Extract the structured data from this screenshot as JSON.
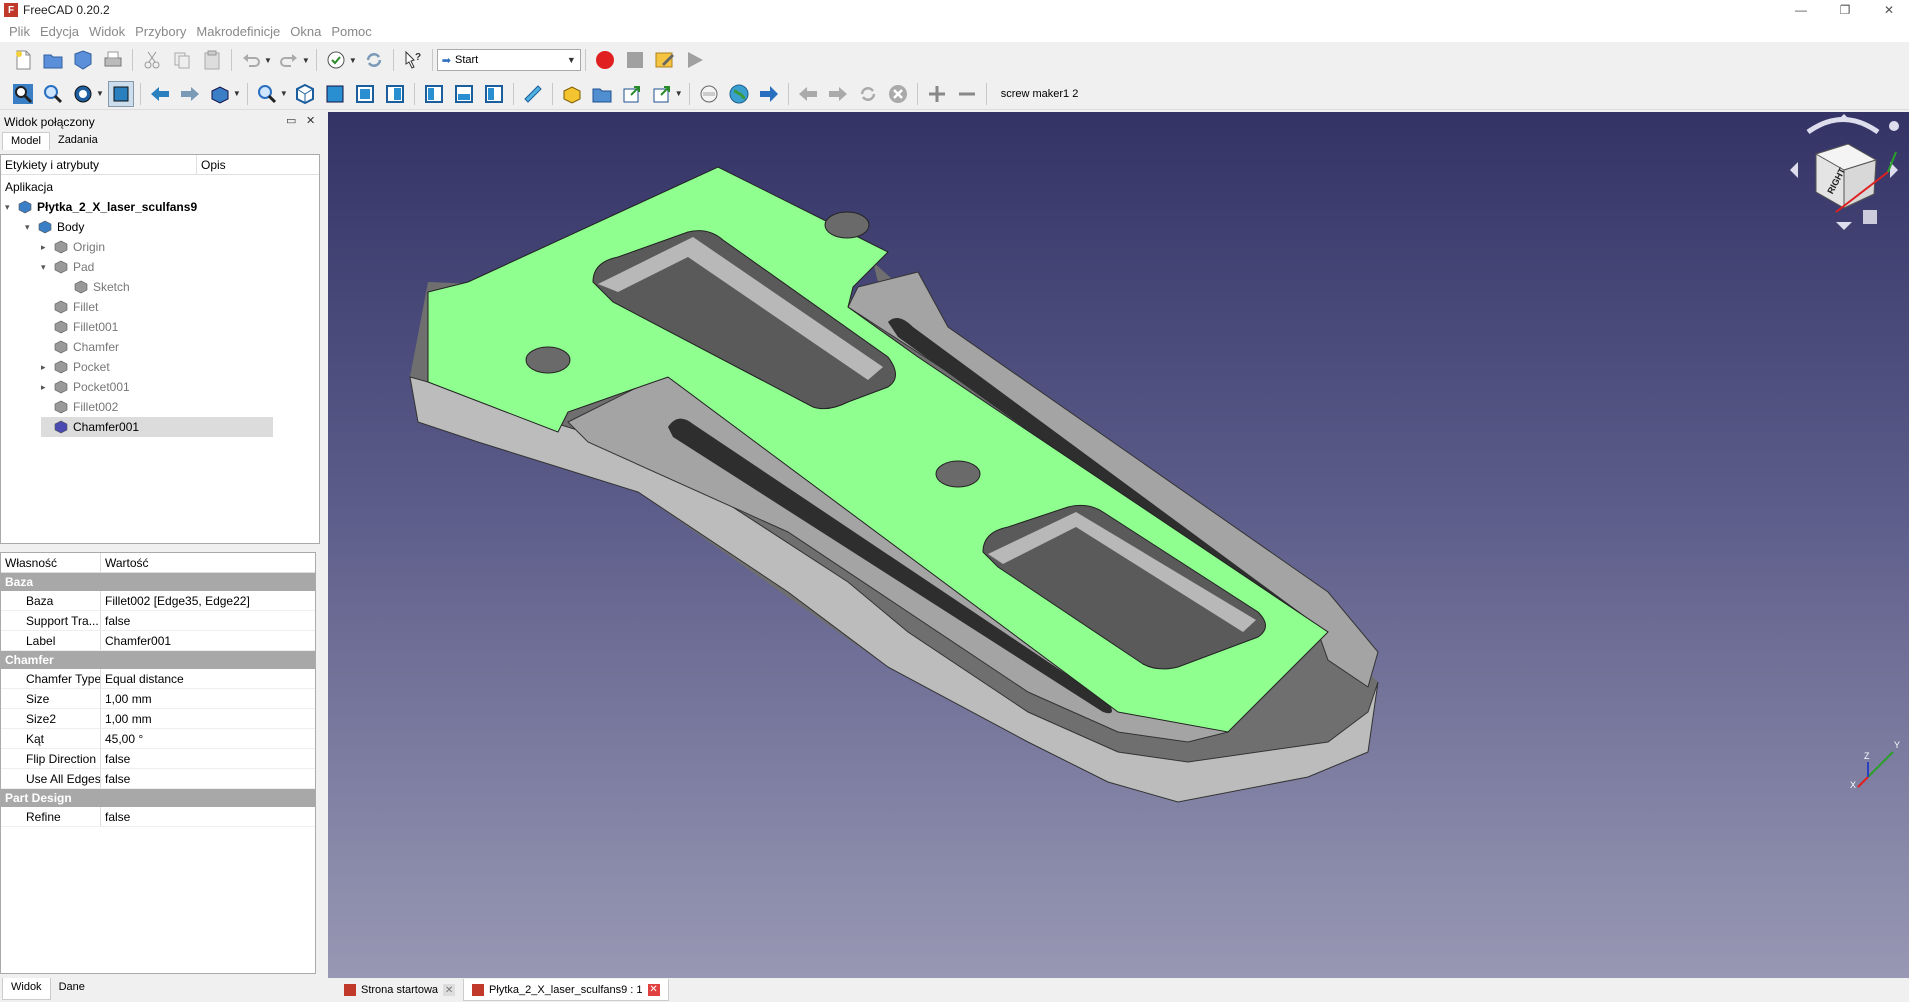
{
  "window": {
    "title": "FreeCAD 0.20.2",
    "controls": [
      "—",
      "❐",
      "✕"
    ]
  },
  "menu": [
    "Plik",
    "Edycja",
    "Widok",
    "Przybory",
    "Makrodefinicje",
    "Okna",
    "Pomoc"
  ],
  "toolbar": {
    "workbench": "Start",
    "macro_label": "screw maker1 2"
  },
  "combo_view": {
    "title": "Widok połączony",
    "float_glyph": "▭",
    "close_glyph": "✕",
    "tabs": [
      "Model",
      "Zadania"
    ],
    "tree_headers": [
      "Etykiety i atrybuty",
      "Opis"
    ],
    "application_label": "Aplikacja",
    "tree": [
      {
        "label": "Płytka_2_X_laser_sculfans9",
        "bold": true,
        "expander": "▾",
        "icon": "document"
      },
      {
        "label": "Body",
        "expander": "▾",
        "icon": "body"
      },
      {
        "label": "Origin",
        "expander": "▸",
        "icon": "origin",
        "gray": true
      },
      {
        "label": "Pad",
        "expander": "▾",
        "icon": "feature",
        "gray": true
      },
      {
        "label": "Sketch",
        "expander": "",
        "icon": "sketch",
        "gray": true
      },
      {
        "label": "Fillet",
        "expander": "",
        "icon": "feature",
        "gray": true
      },
      {
        "label": "Fillet001",
        "expander": "",
        "icon": "feature",
        "gray": true
      },
      {
        "label": "Chamfer",
        "expander": "",
        "icon": "feature",
        "gray": true
      },
      {
        "label": "Pocket",
        "expander": "▸",
        "icon": "feature",
        "gray": true
      },
      {
        "label": "Pocket001",
        "expander": "▸",
        "icon": "feature",
        "gray": true
      },
      {
        "label": "Fillet002",
        "expander": "",
        "icon": "feature",
        "gray": true
      },
      {
        "label": "Chamfer001",
        "expander": "",
        "icon": "chamfer",
        "selected": true
      }
    ]
  },
  "properties": {
    "headers": [
      "Własność",
      "Wartość"
    ],
    "groups": [
      {
        "name": "Baza",
        "rows": [
          {
            "key": "Baza",
            "value": "Fillet002 [Edge35, Edge22]"
          },
          {
            "key": "Support Tra...",
            "value": "false"
          },
          {
            "key": "Label",
            "value": "Chamfer001"
          }
        ]
      },
      {
        "name": "Chamfer",
        "rows": [
          {
            "key": "Chamfer Type",
            "value": "Equal distance"
          },
          {
            "key": "Size",
            "value": "1,00 mm"
          },
          {
            "key": "Size2",
            "value": "1,00 mm"
          },
          {
            "key": "Kąt",
            "value": "45,00 °"
          },
          {
            "key": "Flip Direction",
            "value": "false"
          },
          {
            "key": "Use All Edges",
            "value": "false"
          }
        ]
      },
      {
        "name": "Part Design",
        "rows": [
          {
            "key": "Refine",
            "value": "false"
          }
        ]
      }
    ],
    "bottom_tabs": [
      "Widok",
      "Dane"
    ]
  },
  "navcube": {
    "face_label": "RIGHT"
  },
  "axes": {
    "x": "X",
    "y": "Y",
    "z": "Z"
  },
  "doc_tabs": [
    {
      "label": "Strona startowa",
      "active": false
    },
    {
      "label": "Płytka_2_X_laser_sculfans9 : 1",
      "active": true
    }
  ],
  "colors": {
    "selected_face": "#8fff8f",
    "body_gray": "#b4b4b4",
    "viewport_top": "#333366",
    "viewport_bottom": "#9898b4",
    "record": "#e02020"
  }
}
